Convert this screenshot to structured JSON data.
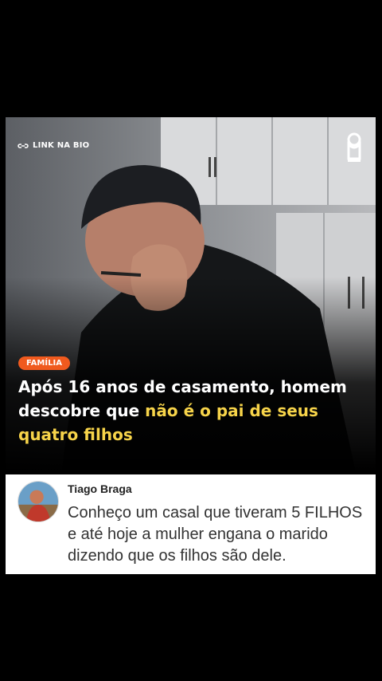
{
  "post": {
    "link_label": "LINK NA BIO",
    "category": "FAMÍLIA",
    "headline_part1": "Após 16 anos de casamento, homem descobre que ",
    "headline_highlight": "não é o pai de seus quatro filhos",
    "highlight_color": "#f7d44a",
    "badge_color": "#f05a1e"
  },
  "comment": {
    "author": "Tiago Braga",
    "text": "Conheço um casal que tiveram 5 FILHOS e até hoje a mulher engana o marido dizendo que os filhos são dele."
  },
  "icons": {
    "link": "link-icon",
    "brand": "brand-logo-icon",
    "avatar": "avatar"
  }
}
